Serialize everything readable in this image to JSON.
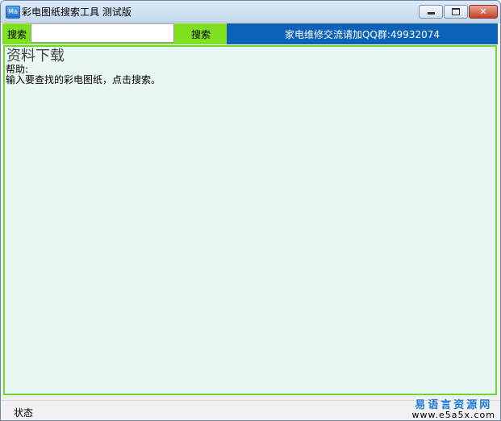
{
  "window": {
    "title": "彩电图纸搜索工具 测试版",
    "icon": "app-icon",
    "icon_glyph": "Ma",
    "minimize_label": "",
    "maximize_label": "",
    "close_label": "✕"
  },
  "toolbar": {
    "search_label": "搜索",
    "search_value": "",
    "search_button": "搜索",
    "qq_banner": "家电维修交流请加QQ群:49932074",
    "colors": {
      "toolbar_bg": "#7fe020",
      "banner_bg": "#0c61b8"
    }
  },
  "content": {
    "title": "资料下载",
    "help_label": "帮助:",
    "help_text": "输入要查找的彩电图纸，点击搜索。",
    "colors": {
      "bg": "#e8f7f6",
      "border": "#6fd82a"
    }
  },
  "statusbar": {
    "status": "状态",
    "watermark_cn": "易语言资源网",
    "watermark_url": "www.e5a5x.com"
  }
}
